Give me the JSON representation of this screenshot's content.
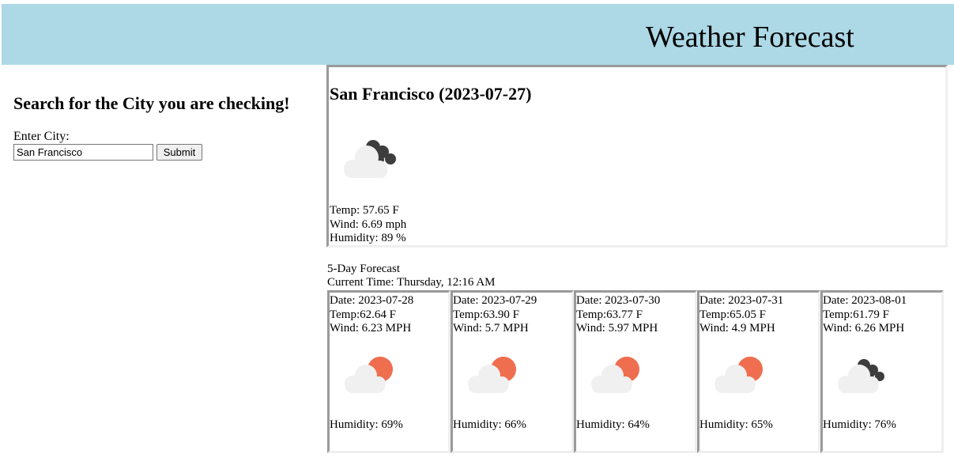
{
  "header": {
    "title": "Weather Forecast",
    "background": "#add8e6"
  },
  "search": {
    "heading": "Search for the City you are checking!",
    "city_label": "Enter City:",
    "city_value": "San Francisco",
    "submit_label": "Submit"
  },
  "current": {
    "title": "San Francisco (2023-07-27)",
    "icon": "cloud-with-dark-cloud-icon",
    "temp": "Temp: 57.65 F",
    "wind": "Wind: 6.69 mph",
    "humidity": "Humidity: 89 %"
  },
  "forecast": {
    "label": "5-Day Forecast",
    "current_time": "Current Time: Thursday, 12:16 AM",
    "days": [
      {
        "date": "Date: 2023-07-28",
        "temp": "Temp:62.64 F",
        "wind": "Wind: 6.23 MPH",
        "humidity": "Humidity: 69%",
        "icon": "cloud-with-sun-icon"
      },
      {
        "date": "Date: 2023-07-29",
        "temp": "Temp:63.90 F",
        "wind": "Wind: 5.7 MPH",
        "humidity": "Humidity: 66%",
        "icon": "cloud-with-sun-icon"
      },
      {
        "date": "Date: 2023-07-30",
        "temp": "Temp:63.77 F",
        "wind": "Wind: 5.97 MPH",
        "humidity": "Humidity: 64%",
        "icon": "cloud-with-sun-icon"
      },
      {
        "date": "Date: 2023-07-31",
        "temp": "Temp:65.05 F",
        "wind": "Wind: 4.9 MPH",
        "humidity": "Humidity: 65%",
        "icon": "cloud-with-sun-icon"
      },
      {
        "date": "Date: 2023-08-01",
        "temp": "Temp:61.79 F",
        "wind": "Wind: 6.26 MPH",
        "humidity": "Humidity: 76%",
        "icon": "cloud-with-dark-cloud-icon"
      }
    ]
  },
  "colors": {
    "sun": "#ee6e4f",
    "cloud": "#f0f0f0",
    "dark_cloud": "#3d3d3d"
  }
}
